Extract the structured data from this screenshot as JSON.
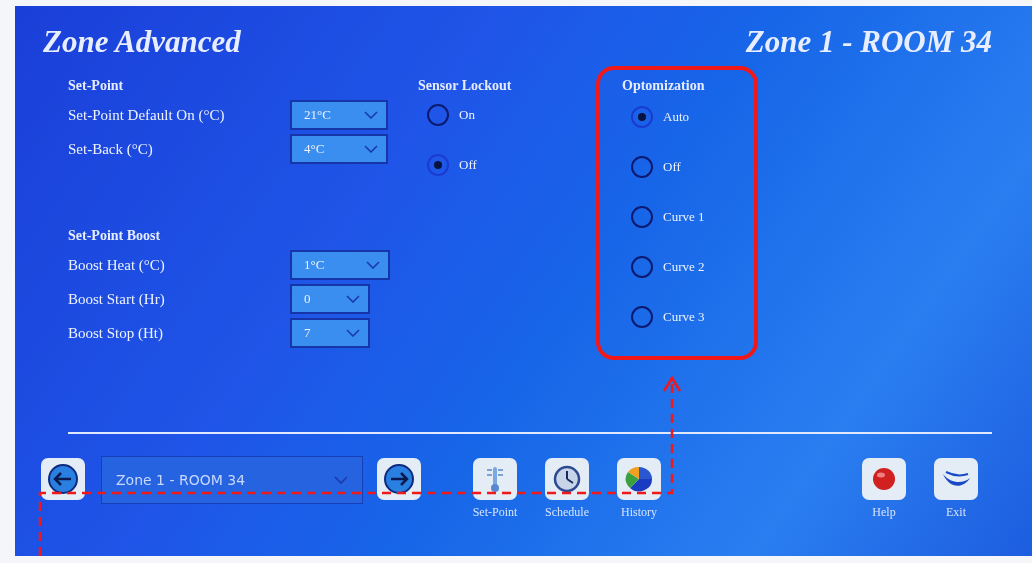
{
  "title": "Zone Advanced",
  "zone_name": "Zone 1 - ROOM 34",
  "setpoint": {
    "heading": "Set-Point",
    "rows": [
      {
        "label": "Set-Point Default On (°C)",
        "value": "21°C"
      },
      {
        "label": "Set-Back (°C)",
        "value": "4°C"
      }
    ]
  },
  "sensor_lockout": {
    "heading": "Sensor Lockout",
    "options": [
      {
        "label": "On",
        "selected": false
      },
      {
        "label": "Off",
        "selected": true
      }
    ]
  },
  "optimization": {
    "heading": "Optomization",
    "options": [
      {
        "label": "Auto",
        "selected": true
      },
      {
        "label": "Off",
        "selected": false
      },
      {
        "label": "Curve 1",
        "selected": false
      },
      {
        "label": "Curve 2",
        "selected": false
      },
      {
        "label": "Curve 3",
        "selected": false
      }
    ]
  },
  "boost": {
    "heading": "Set-Point Boost",
    "rows": [
      {
        "label": "Boost Heat (°C)",
        "value": "1°C"
      },
      {
        "label": "Boost Start (Hr)",
        "value": "0"
      },
      {
        "label": "Boost Stop (Ht)",
        "value": "7"
      }
    ]
  },
  "zone_select": {
    "value": "Zone 1 - ROOM 34"
  },
  "toolbar": [
    {
      "kind": "setpoint",
      "label": "Set-Point"
    },
    {
      "kind": "schedule",
      "label": "Schedule"
    },
    {
      "kind": "history",
      "label": "History"
    },
    {
      "kind": "gap"
    },
    {
      "kind": "help",
      "label": "Help"
    },
    {
      "kind": "exit",
      "label": "Exit"
    }
  ]
}
